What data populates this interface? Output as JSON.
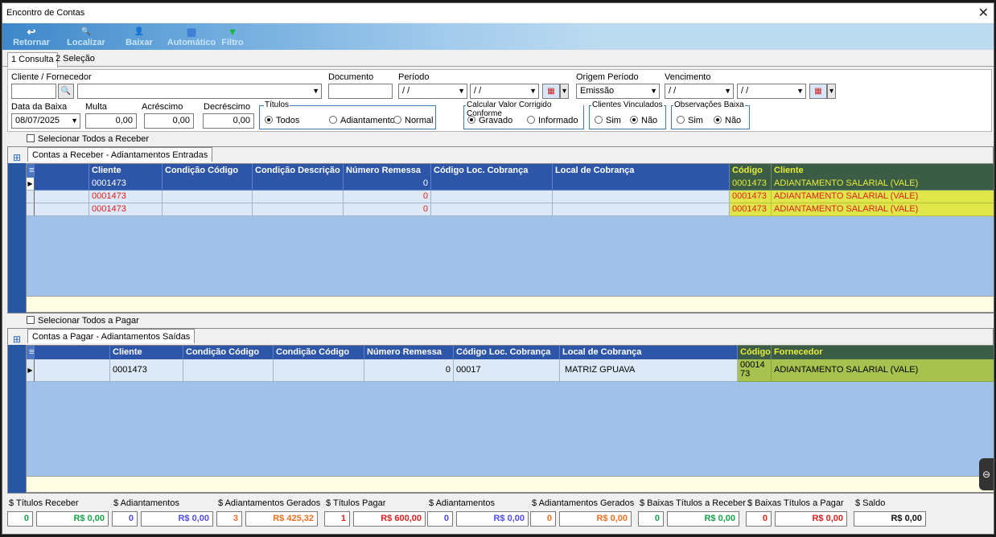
{
  "window": {
    "title": "Encontro de Contas",
    "close_glyph": "✕"
  },
  "toolbar": [
    {
      "label": "Retornar",
      "icon": "↩"
    },
    {
      "label": "Localizar",
      "icon": "🔍"
    },
    {
      "label": "Baixar",
      "icon": "👤"
    },
    {
      "label": "Automático",
      "icon": "▦"
    },
    {
      "label": "Filtro",
      "icon": "▼"
    }
  ],
  "tabs": [
    {
      "label": "1 Consulta",
      "active": true
    },
    {
      "label": "2 Seleção",
      "active": false
    }
  ],
  "filters": {
    "cliente_label": "Cliente / Fornecedor",
    "documento_label": "Documento",
    "periodo_label": "Período",
    "periodo_de": "/ /",
    "periodo_ate": "/ /",
    "origem_label": "Origem Período",
    "origem_value": "Emissão",
    "vencimento_label": "Vencimento",
    "vencimento_de": "/ /",
    "vencimento_ate": "/ /",
    "data_baixa_label": "Data da Baixa",
    "data_baixa_value": "08/07/2025",
    "multa_label": "Multa",
    "multa_value": "0,00",
    "acrescimo_label": "Acréscimo",
    "acrescimo_value": "0,00",
    "decrescimo_label": "Decréscimo",
    "decrescimo_value": "0,00",
    "titulos": {
      "title": "Títulos",
      "opt1": "Todos",
      "opt2": "Adiantamentos",
      "opt3": "Normal"
    },
    "calcular": {
      "title": "Calcular Valor Corrigido Conforme",
      "opt1": "Gravado",
      "opt2": "Informado"
    },
    "vinculados": {
      "title": "Clientes Vinculados",
      "opt1": "Sim",
      "opt2": "Não"
    },
    "observacoes": {
      "title": "Observações Baixa",
      "opt1": "Sim",
      "opt2": "Não"
    }
  },
  "receber": {
    "select_all": "Selecionar Todos a Receber",
    "tab_label": "Contas a Receber - Adiantamentos Entradas",
    "columns": [
      "Cliente",
      "Condição Código",
      "Condição Descrição",
      "Número Remessa",
      "Código Loc. Cobrança",
      "Local de Cobrança",
      "Código",
      "Cliente"
    ],
    "rows": [
      {
        "cliente": "0001473",
        "cond_cod": "",
        "cond_desc": "",
        "remessa": "0",
        "loc_cod": "",
        "local": "",
        "codigo": "0001473",
        "nome": "ADIANTAMENTO SALARIAL (VALE)"
      },
      {
        "cliente": "0001473",
        "cond_cod": "",
        "cond_desc": "",
        "remessa": "0",
        "loc_cod": "",
        "local": "",
        "codigo": "0001473",
        "nome": "ADIANTAMENTO SALARIAL (VALE)"
      },
      {
        "cliente": "0001473",
        "cond_cod": "",
        "cond_desc": "",
        "remessa": "0",
        "loc_cod": "",
        "local": "",
        "codigo": "0001473",
        "nome": "ADIANTAMENTO SALARIAL (VALE)"
      }
    ]
  },
  "pagar": {
    "select_all": "Selecionar Todos a Pagar",
    "tab_label": "Contas a Pagar - Adiantamentos Saídas",
    "columns": [
      "Cliente",
      "Condição Código",
      "Condição Código",
      "Número Remessa",
      "Código Loc. Cobrança",
      "Local de Cobrança",
      "Código",
      "Fornecedor"
    ],
    "rows": [
      {
        "cliente": "0001473",
        "cond_cod": "",
        "cond_desc": "",
        "remessa": "0",
        "loc_cod": "00017",
        "local": "MATRIZ GPUAVA",
        "codigo": "0001473",
        "nome": "ADIANTAMENTO SALARIAL (VALE)"
      }
    ]
  },
  "totals": {
    "titulos_receber": {
      "label": "$ Títulos Receber",
      "count": "0",
      "value": "R$ 0,00"
    },
    "adiantamentos_r": {
      "label": "$ Adiantamentos",
      "count": "0",
      "value": "R$ 0,00"
    },
    "adiant_gerados_r": {
      "label": "$ Adiantamentos Gerados",
      "count": "3",
      "value": "R$ 425,32"
    },
    "titulos_pagar": {
      "label": "$ Títulos Pagar",
      "count": "1",
      "value": "R$ 600,00"
    },
    "adiantamentos_p": {
      "label": "$ Adiantamentos",
      "count": "0",
      "value": "R$ 0,00"
    },
    "adiant_gerados_p": {
      "label": "$ Adiantamentos Gerados",
      "count": "0",
      "value": "R$ 0,00"
    },
    "baixas_receber": {
      "label": "$ Baixas Títulos a Receber",
      "count": "0",
      "value": "R$ 0,00"
    },
    "baixas_pagar": {
      "label": "$ Baixas Títulos a Pagar",
      "count": "0",
      "value": "R$ 0,00"
    },
    "saldo": {
      "label": "$ Saldo",
      "value": "R$ 0,00"
    }
  }
}
